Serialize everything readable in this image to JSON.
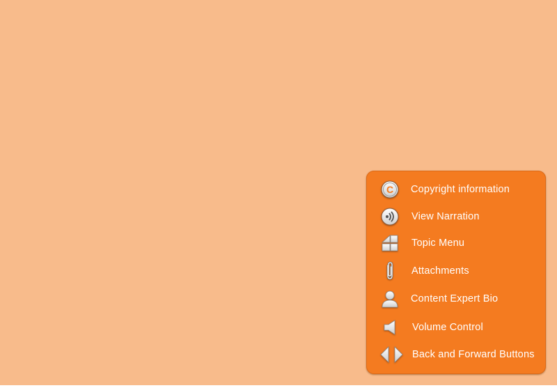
{
  "legend": {
    "items": [
      {
        "icon": "copyright-icon",
        "label": "Copyright information"
      },
      {
        "icon": "narration-icon",
        "label": "View Narration"
      },
      {
        "icon": "topic-menu-icon",
        "label": "Topic Menu"
      },
      {
        "icon": "paperclip-icon",
        "label": "Attachments"
      },
      {
        "icon": "person-icon",
        "label": "Content Expert Bio"
      },
      {
        "icon": "speaker-icon",
        "label": "Volume Control"
      },
      {
        "icon": "back-forward-arrows-icon",
        "label": "Back and Forward Buttons"
      }
    ]
  },
  "colors": {
    "background": "#f8bb8b",
    "panel": "#f47b20",
    "text": "#ffffff"
  }
}
